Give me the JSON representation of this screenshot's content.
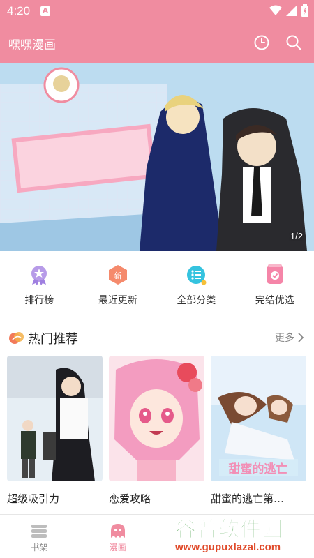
{
  "status_bar": {
    "time": "4:20",
    "notification_letter": "A"
  },
  "app_bar": {
    "title": "嘿嘿漫画"
  },
  "banner": {
    "pager": "1/2"
  },
  "quick_nav": [
    {
      "label": "排行榜",
      "icon": "ranking-badge-icon"
    },
    {
      "label": "最近更新",
      "icon": "new-hexagon-icon"
    },
    {
      "label": "全部分类",
      "icon": "category-list-icon"
    },
    {
      "label": "完结优选",
      "icon": "finished-check-icon"
    }
  ],
  "section": {
    "title": "热门推荐",
    "more_label": "更多"
  },
  "cards": [
    {
      "title": "超级吸引力"
    },
    {
      "title": "恋爱攻略"
    },
    {
      "title": "甜蜜的逃亡第…"
    }
  ],
  "bottom_nav": [
    {
      "label": "书架",
      "active": false
    },
    {
      "label": "漫画",
      "active": true
    }
  ],
  "watermark": {
    "title": "谷普软件园",
    "url": "www.gupuxlazal.com"
  },
  "colors": {
    "accent": "#f08ca0",
    "text": "#222222",
    "muted": "#888888"
  }
}
